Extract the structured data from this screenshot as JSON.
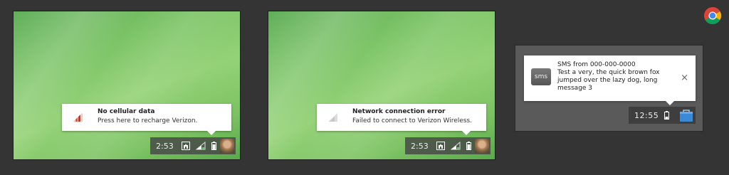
{
  "screens": [
    {
      "notification": {
        "title": "No cellular data",
        "message": "Press here to recharge Verizon.",
        "icon": "cellular-signal-red-icon"
      },
      "tray": {
        "time": "2:53"
      }
    },
    {
      "notification": {
        "title": "Network connection error",
        "message": "Failed to connect to Verizon Wireless.",
        "icon": "cellular-signal-gray-icon"
      },
      "tray": {
        "time": "2:53"
      }
    },
    {
      "notification": {
        "icon_label": "sms",
        "title": "SMS from 000-000-0000",
        "message": "Test a very, the quick brown fox jumped over the lazy dog, long message 3",
        "close": "×"
      },
      "tray": {
        "time": "12:55"
      }
    }
  ],
  "colors": {
    "background": "#343434",
    "wallpaper": "#7cc466",
    "signal_warning": "#c0392b",
    "bag_icon": "#3b8ad8"
  }
}
